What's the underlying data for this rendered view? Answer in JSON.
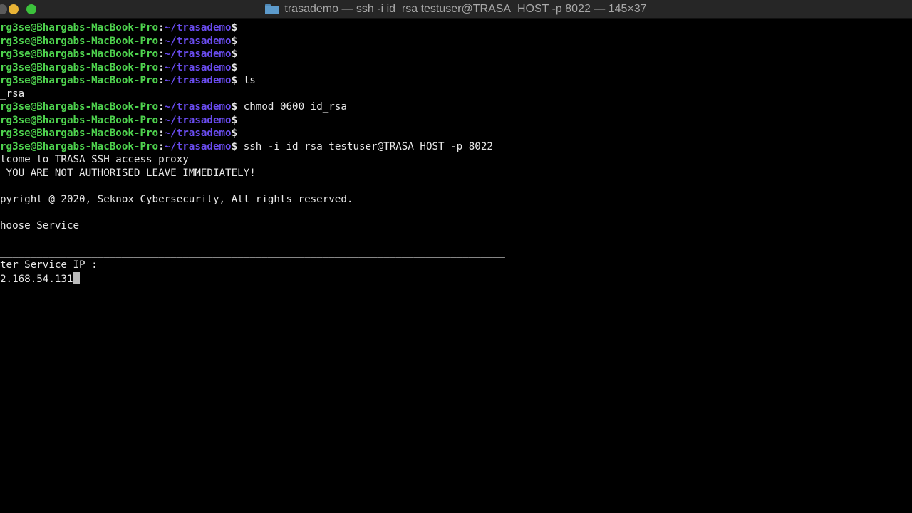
{
  "window": {
    "title": "trasademo — ssh -i id_rsa testuser@TRASA_HOST -p 8022 — 145×37"
  },
  "prompt": {
    "user": "rg3se@Bhargabs-MacBook-Pro",
    "colon": ":",
    "path": "~/trasademo",
    "dollar": "$"
  },
  "lines": [
    {
      "kind": "prompt",
      "cmd": ""
    },
    {
      "kind": "prompt",
      "cmd": ""
    },
    {
      "kind": "prompt",
      "cmd": ""
    },
    {
      "kind": "prompt",
      "cmd": ""
    },
    {
      "kind": "prompt",
      "cmd": " ls"
    },
    {
      "kind": "text",
      "text": "_rsa"
    },
    {
      "kind": "prompt",
      "cmd": " chmod 0600 id_rsa"
    },
    {
      "kind": "prompt",
      "cmd": ""
    },
    {
      "kind": "prompt",
      "cmd": ""
    },
    {
      "kind": "prompt",
      "cmd": " ssh -i id_rsa testuser@TRASA_HOST -p 8022"
    },
    {
      "kind": "text",
      "text": "lcome to TRASA SSH access proxy"
    },
    {
      "kind": "text",
      "text": " YOU ARE NOT AUTHORISED LEAVE IMMEDIATELY!"
    },
    {
      "kind": "text",
      "text": ""
    },
    {
      "kind": "text",
      "text": "pyright @ 2020, Seknox Cybersecurity, All rights reserved."
    },
    {
      "kind": "text",
      "text": ""
    },
    {
      "kind": "text",
      "text": "hoose Service"
    },
    {
      "kind": "text",
      "text": ""
    },
    {
      "kind": "separator",
      "text": "___________________________________________________________________________________"
    },
    {
      "kind": "text",
      "text": "ter Service IP :"
    },
    {
      "kind": "input",
      "text": "2.168.54.131"
    }
  ],
  "icons": {
    "folder": "folder-icon"
  },
  "colors": {
    "user": "#4ed24e",
    "path": "#6a4cf0",
    "text": "#e8e8e8",
    "background": "#000000",
    "titlebar": "#262626",
    "minimize": "#e8b336",
    "maximize": "#3cc23c"
  }
}
